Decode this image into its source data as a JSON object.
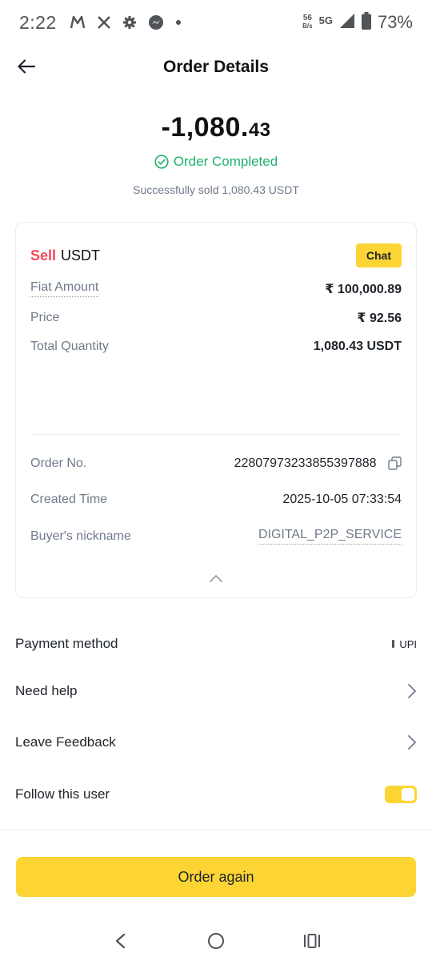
{
  "status_bar": {
    "time": "2:22",
    "net_speed_value": "56",
    "net_speed_unit": "B/s",
    "network": "5G",
    "battery": "73%"
  },
  "header": {
    "title": "Order Details"
  },
  "summary": {
    "amount_main": "-1,080.",
    "amount_decimals": "43",
    "status": "Order Completed",
    "subtitle": "Successfully sold 1,080.43 USDT"
  },
  "card": {
    "side": "Sell",
    "asset": "USDT",
    "chat_label": "Chat",
    "rows": [
      {
        "label": "Fiat Amount",
        "value": "₹ 100,000.89"
      },
      {
        "label": "Price",
        "value": "₹ 92.56"
      },
      {
        "label": "Total Quantity",
        "value": "1,080.43 USDT"
      }
    ],
    "details": [
      {
        "label": "Order No.",
        "value": "22807973233855397888"
      },
      {
        "label": "Created Time",
        "value": "2025-10-05 07:33:54"
      },
      {
        "label": "Buyer's nickname",
        "value": "DIGITAL_P2P_SERVICE"
      }
    ]
  },
  "list": {
    "payment_method_label": "Payment method",
    "payment_method_value": "UPI",
    "need_help": "Need help",
    "leave_feedback": "Leave Feedback",
    "follow_user": "Follow this user",
    "follow_enabled": true
  },
  "primary_button": "Order again",
  "colors": {
    "accent": "#fcd535",
    "success": "#20b26c",
    "sell": "#f6465d"
  }
}
